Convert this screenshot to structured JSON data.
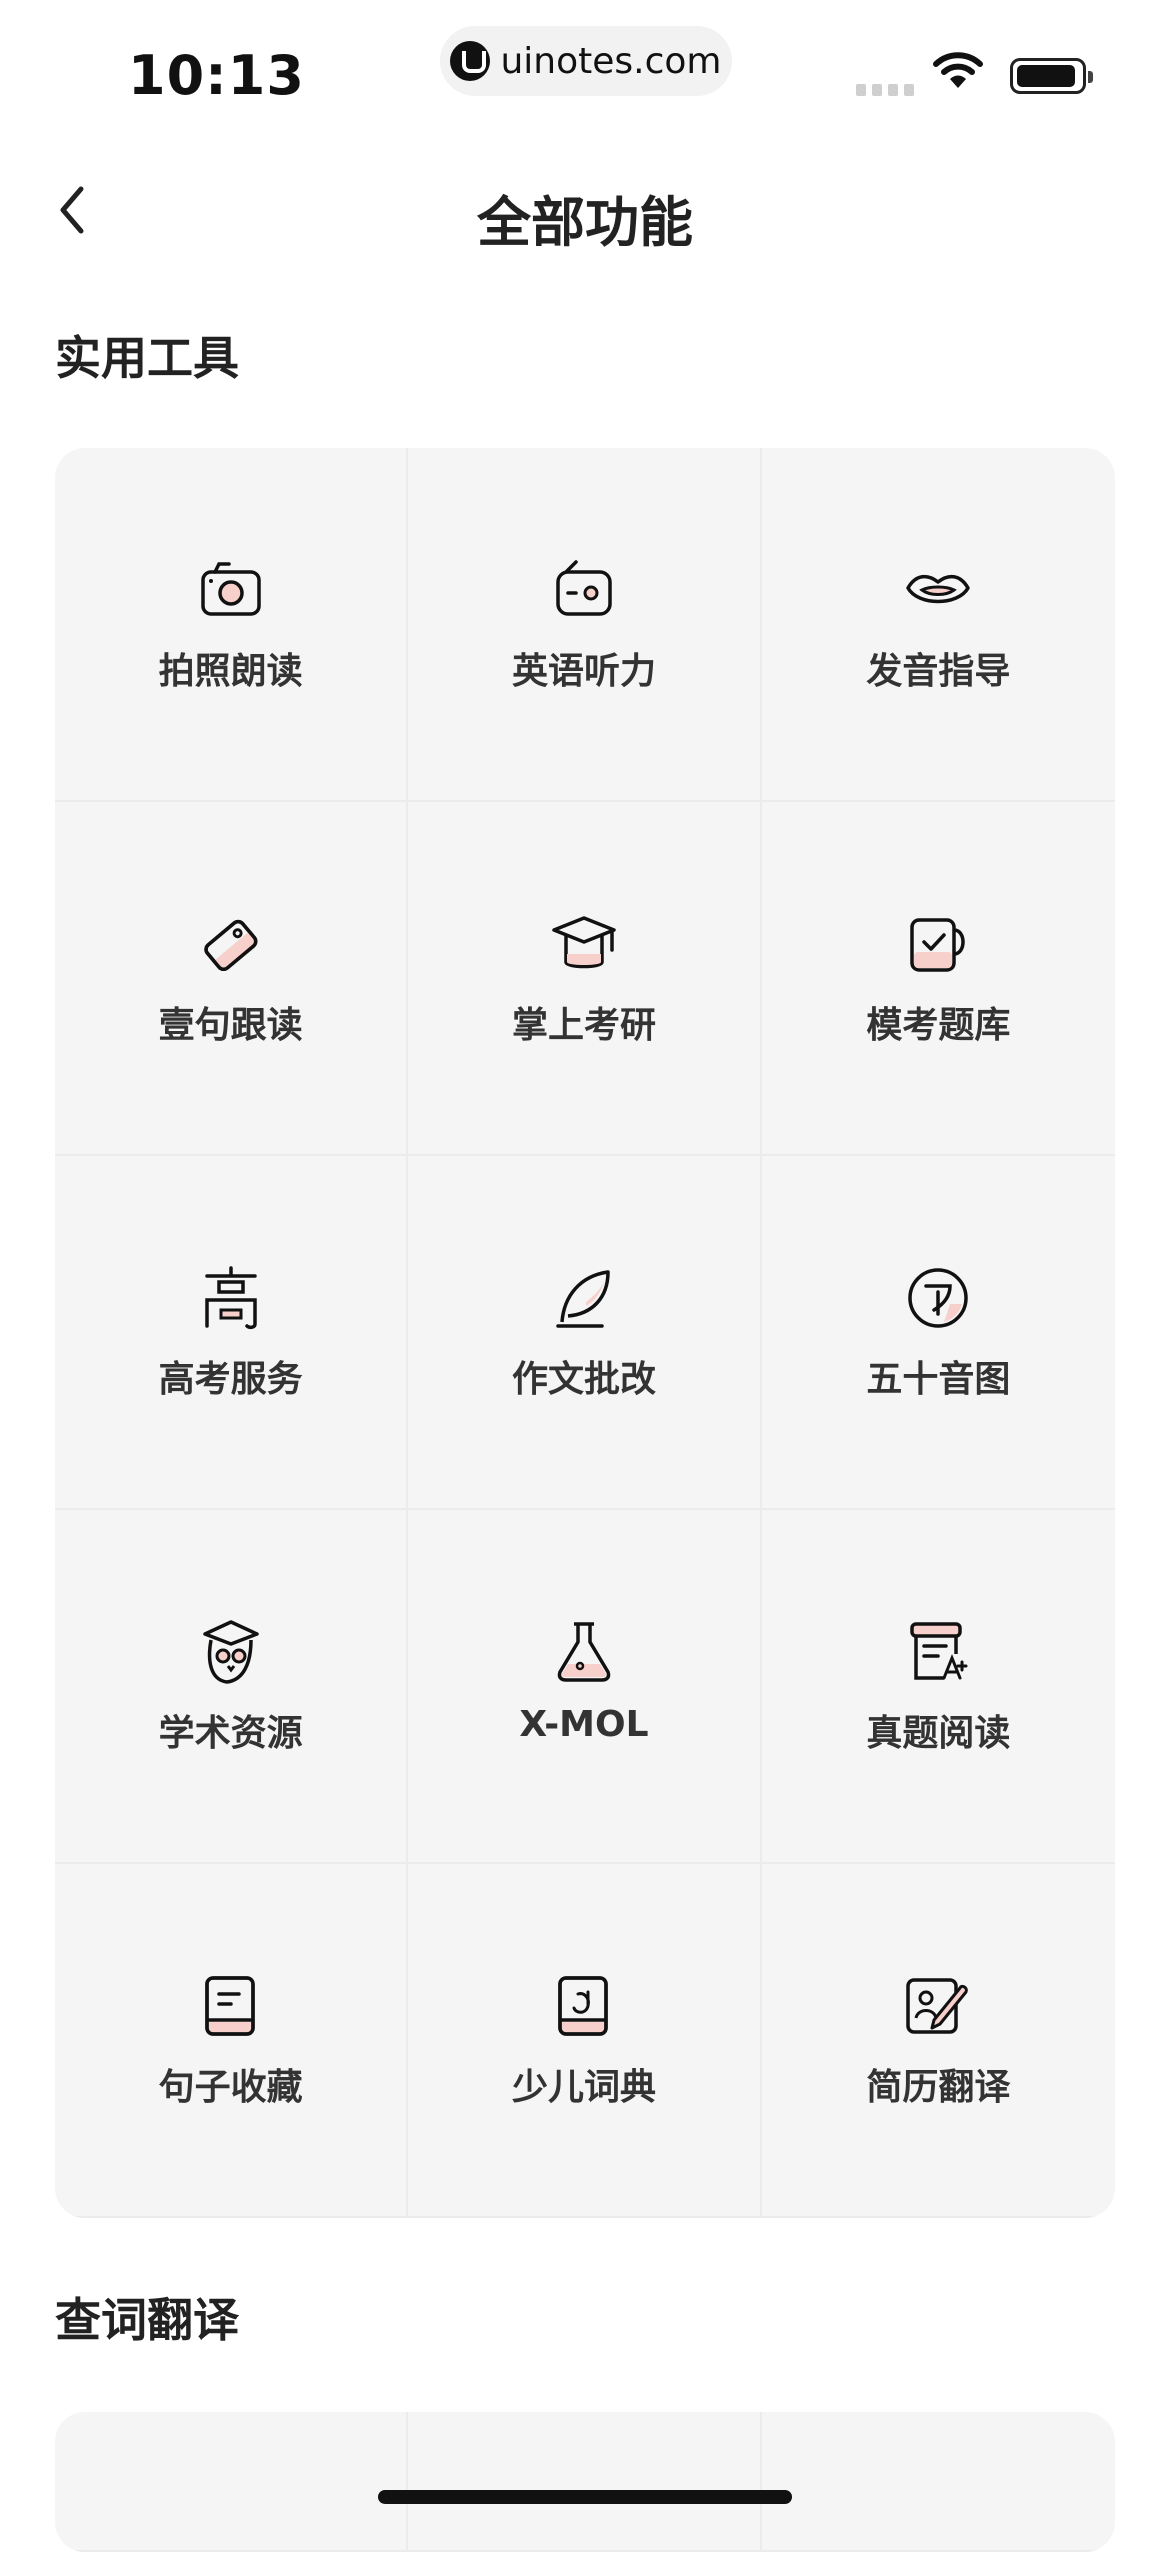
{
  "status_bar": {
    "time": "10:13",
    "url": "uinotes.com"
  },
  "nav": {
    "title": "全部功能",
    "back_icon": "chevron-left-icon"
  },
  "sections": [
    {
      "title": "实用工具",
      "items": [
        {
          "label": "拍照朗读",
          "icon": "camera-icon"
        },
        {
          "label": "英语听力",
          "icon": "radio-icon"
        },
        {
          "label": "发音指导",
          "icon": "lips-icon"
        },
        {
          "label": "壹句跟读",
          "icon": "tag-icon"
        },
        {
          "label": "掌上考研",
          "icon": "graduation-cap-icon"
        },
        {
          "label": "模考题库",
          "icon": "checklist-icon"
        },
        {
          "label": "高考服务",
          "icon": "gao-char-icon"
        },
        {
          "label": "作文批改",
          "icon": "feather-icon"
        },
        {
          "label": "五十音图",
          "icon": "kana-icon"
        },
        {
          "label": "学术资源",
          "icon": "owl-icon"
        },
        {
          "label": "X-MOL",
          "icon": "flask-icon"
        },
        {
          "label": "真题阅读",
          "icon": "scroll-icon"
        },
        {
          "label": "句子收藏",
          "icon": "book-icon"
        },
        {
          "label": "少儿词典",
          "icon": "kids-dictionary-icon"
        },
        {
          "label": "简历翻译",
          "icon": "resume-edit-icon"
        }
      ]
    },
    {
      "title": "查词翻译"
    }
  ],
  "colors": {
    "accent_pink": "#f7cfcb",
    "card_bg": "#f5f5f5",
    "text": "#222222"
  }
}
